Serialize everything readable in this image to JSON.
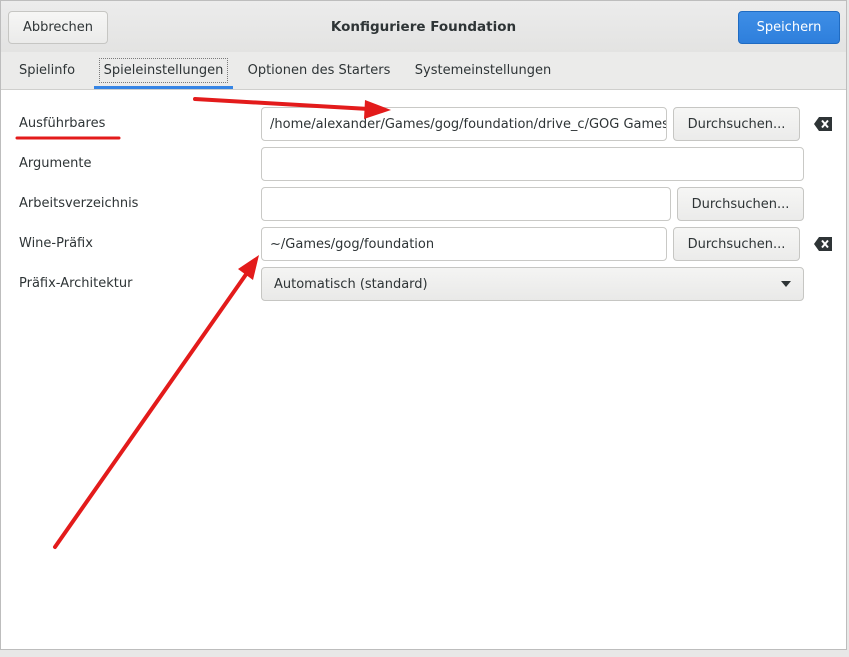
{
  "header": {
    "cancel_label": "Abbrechen",
    "title": "Konfiguriere Foundation",
    "save_label": "Speichern"
  },
  "tabs": [
    {
      "label": "Spielinfo",
      "active": false
    },
    {
      "label": "Spieleinstellungen",
      "active": true
    },
    {
      "label": "Optionen des Starters",
      "active": false
    },
    {
      "label": "Systemeinstellungen",
      "active": false
    }
  ],
  "form": {
    "executable": {
      "label": "Ausführbares",
      "value": "/home/alexander/Games/gog/foundation/drive_c/GOG Games/Foundation/foundation.exe",
      "browse_label": "Durchsuchen..."
    },
    "arguments": {
      "label": "Argumente",
      "value": ""
    },
    "workdir": {
      "label": "Arbeitsverzeichnis",
      "value": "",
      "browse_label": "Durchsuchen..."
    },
    "prefix": {
      "label": "Wine-Präfix",
      "value": "~/Games/gog/foundation",
      "browse_label": "Durchsuchen..."
    },
    "arch": {
      "label": "Präfix-Architektur",
      "selected": "Automatisch (standard)"
    }
  },
  "colors": {
    "accent": "#3584e4",
    "annotation": "#e31b1b"
  }
}
